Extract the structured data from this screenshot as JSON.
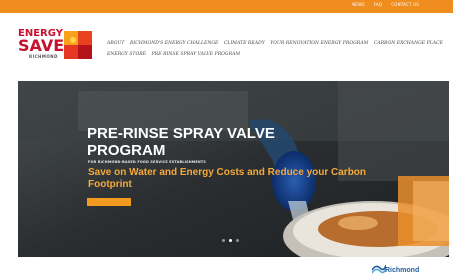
{
  "topbar": {
    "links": [
      "NEWS",
      "FAQ",
      "CONTACT US"
    ]
  },
  "logo": {
    "line1": "ENERGY",
    "line2": "SAVE",
    "line3": "RICHMOND"
  },
  "nav": {
    "items": [
      "ABOUT",
      "RICHMOND'S ENERGY CHALLENGE",
      "CLIMATE READY",
      "YOUR RENOVATION ENERGY PROGRAM",
      "CARBON EXCHANGE PLACE",
      "ENERGY STORE",
      "PRE-RINSE SPRAY VALVE PROGRAM"
    ]
  },
  "hero": {
    "title": "PRE-RINSE SPRAY VALVE PROGRAM",
    "subtitle": "FOR RICHMOND-BASED FOOD SERVICE ESTABLISHMENTS",
    "cta": "Save on Water and Energy Costs and Reduce your Carbon Footprint",
    "button_label": "",
    "slides": 3,
    "active_slide": 1
  },
  "footer": {
    "left_top": "",
    "left_bottom": "",
    "right": "",
    "partner": "Richmond"
  },
  "colors": {
    "accent": "#ef8d1e",
    "brand_red": "#c8102e",
    "hero_text": "#f5a93a",
    "richmond_blue": "#1f5f9c"
  }
}
